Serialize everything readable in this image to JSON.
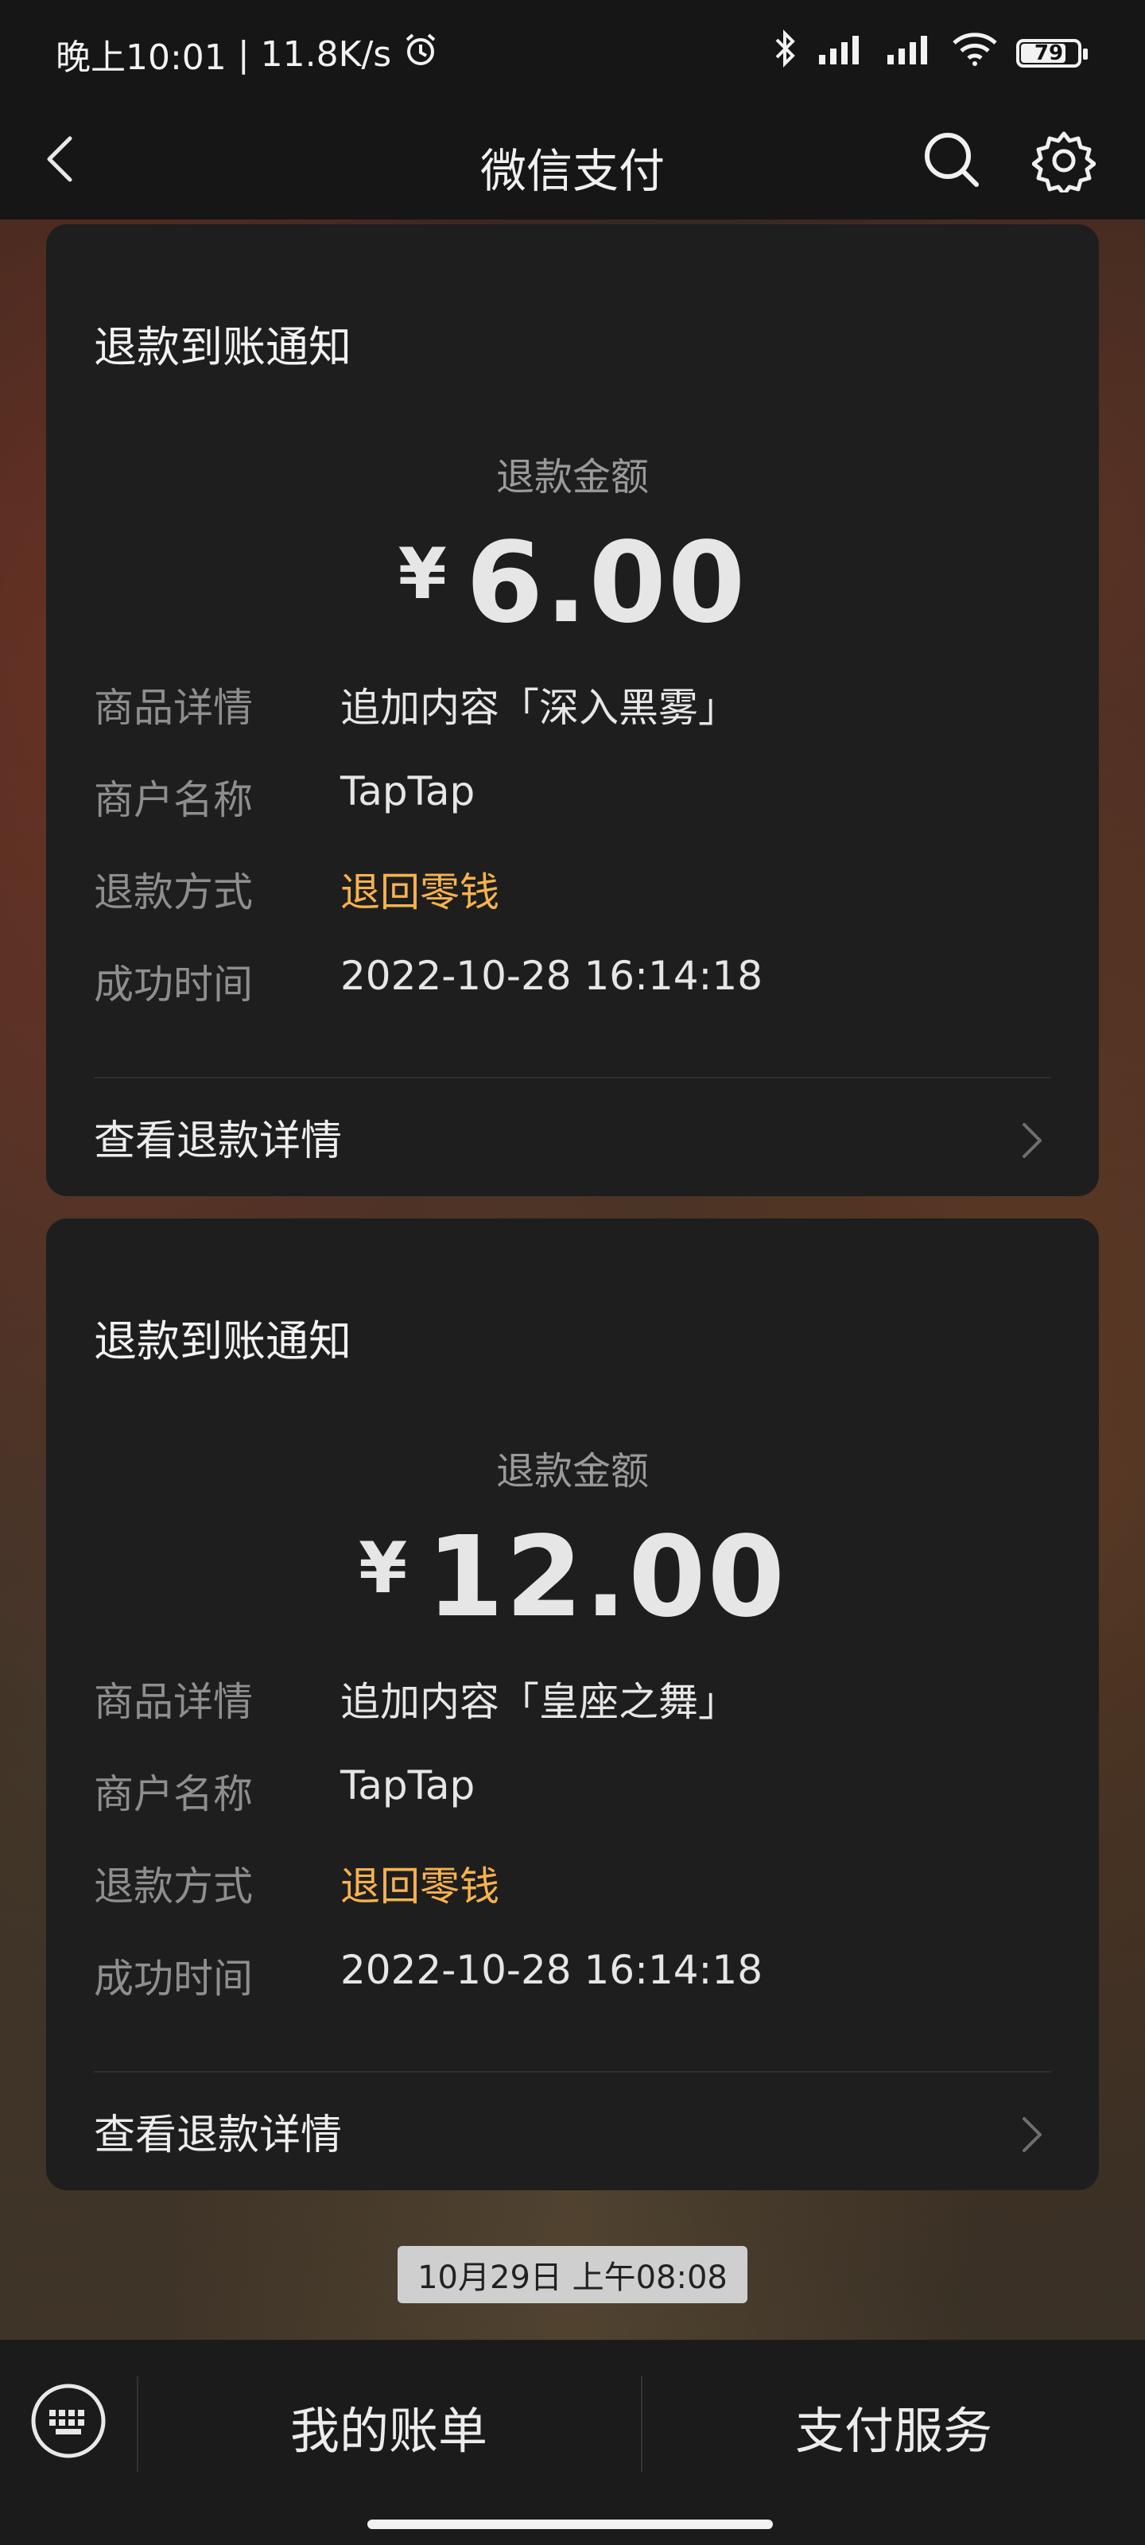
{
  "status_bar": {
    "time": "晚上10:01",
    "sep": "|",
    "speed": "11.8K/s",
    "battery": "79"
  },
  "nav": {
    "title": "微信支付"
  },
  "cards": [
    {
      "title": "退款到账通知",
      "amount_label": "退款金额",
      "currency": "¥",
      "amount": "6.00",
      "rows": [
        {
          "key": "商品详情",
          "value": "追加内容「深入黑雾」"
        },
        {
          "key": "商户名称",
          "value": "TapTap"
        },
        {
          "key": "退款方式",
          "value": "退回零钱"
        },
        {
          "key": "成功时间",
          "value": "2022-10-28 16:14:18"
        }
      ],
      "link": "查看退款详情"
    },
    {
      "title": "退款到账通知",
      "amount_label": "退款金额",
      "currency": "¥",
      "amount": "12.00",
      "rows": [
        {
          "key": "商品详情",
          "value": " 追加内容「皇座之舞」"
        },
        {
          "key": "商户名称",
          "value": "TapTap"
        },
        {
          "key": "退款方式",
          "value": "退回零钱"
        },
        {
          "key": "成功时间",
          "value": "2022-10-28 16:14:18"
        }
      ],
      "link": "查看退款详情"
    }
  ],
  "timestamp": "10月29日 上午08:08",
  "bottom": {
    "bill": "我的账单",
    "services": "支付服务"
  },
  "colors": {
    "accent_orange": "#f6b24e",
    "card_bg": "#1e1e1e"
  }
}
